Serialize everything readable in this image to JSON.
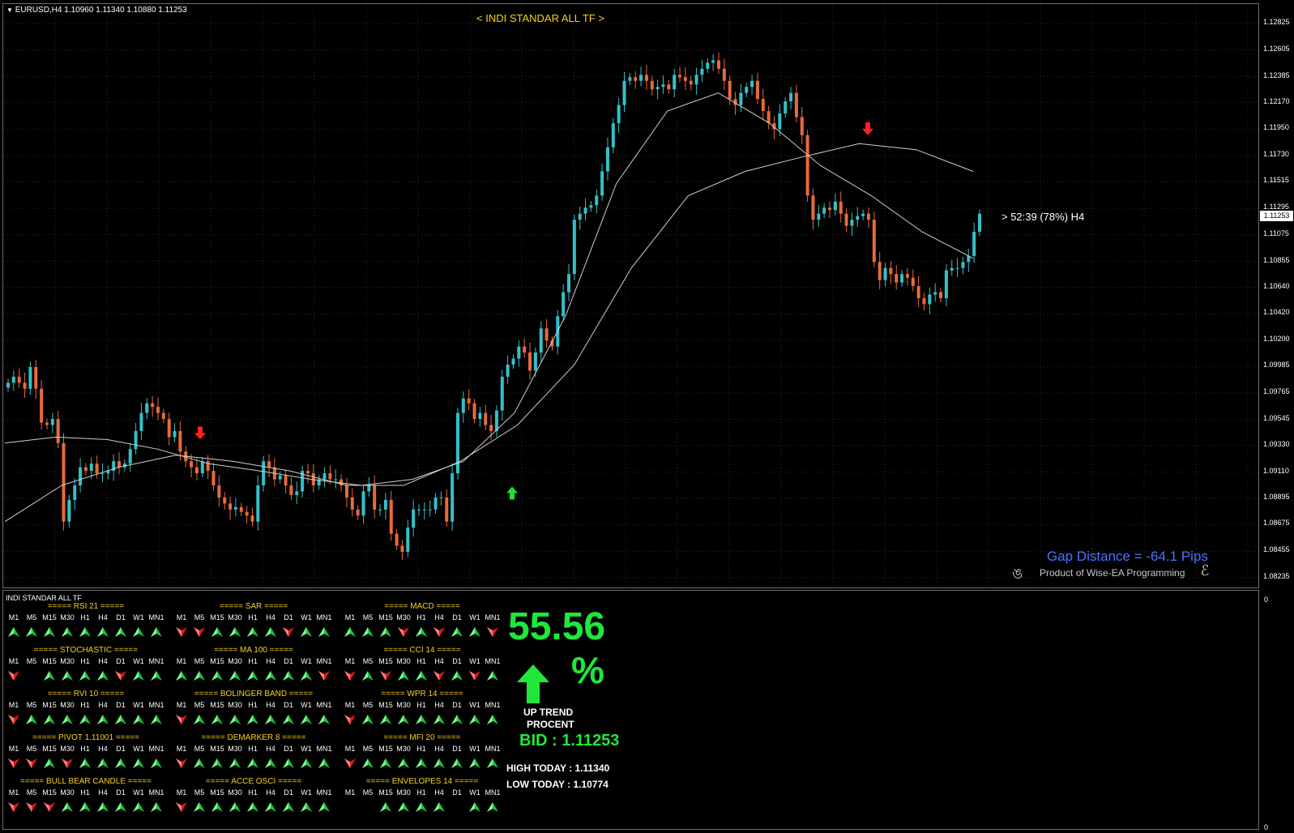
{
  "chart": {
    "symbol_header": "EURUSD,H4  1.10960 1.11340 1.10880 1.11253",
    "indicator_title": "< INDI STANDAR ALL TF >",
    "countdown": "> 52:39 (78%) H4",
    "gap_distance": "Gap Distance = -64.1 Pips",
    "product_credit": "Product of Wise-EA Programming",
    "current_price_tag": "1.11253",
    "price_ticks": [
      "1.12825",
      "1.12605",
      "1.12385",
      "1.12170",
      "1.11950",
      "1.11730",
      "1.11515",
      "1.11295",
      "1.11075",
      "1.10855",
      "1.10640",
      "1.10420",
      "1.10200",
      "1.09985",
      "1.09765",
      "1.09545",
      "1.09330",
      "1.09110",
      "1.08895",
      "1.08675",
      "1.08455",
      "1.08235"
    ],
    "colors": {
      "bull": "#35c0c8",
      "bear": "#e86a3a",
      "ma": "#cfcfcf",
      "signal_down": "#ff2020",
      "signal_up": "#20e030"
    }
  },
  "chart_data": {
    "type": "candlestick",
    "symbol": "EURUSD",
    "timeframe": "H4",
    "ylim": [
      1.08235,
      1.12825
    ],
    "close": [
      1.0985,
      1.099,
      1.0985,
      1.098,
      1.0998,
      1.098,
      1.0952,
      1.095,
      1.0955,
      1.0935,
      1.087,
      1.0888,
      1.09,
      1.0915,
      1.0912,
      1.0918,
      1.091,
      1.091,
      1.0912,
      1.092,
      1.0915,
      1.0918,
      1.093,
      1.0945,
      1.096,
      1.0968,
      1.0965,
      1.096,
      1.0955,
      1.094,
      1.0945,
      1.0928,
      1.092,
      1.0915,
      1.091,
      1.092,
      1.0912,
      1.09,
      1.089,
      1.0885,
      1.088,
      1.0882,
      1.0878,
      1.0875,
      1.087,
      1.09,
      1.092,
      1.0915,
      1.0905,
      1.0908,
      1.09,
      1.0892,
      1.0895,
      1.0912,
      1.091,
      1.09,
      1.0905,
      1.091,
      1.0905,
      1.0905,
      1.09,
      1.089,
      1.088,
      1.0875,
      1.0895,
      1.09,
      1.088,
      1.088,
      1.0888,
      1.086,
      1.085,
      1.0845,
      1.0865,
      1.088,
      1.088,
      1.088,
      1.088,
      1.089,
      1.089,
      1.087,
      1.091,
      1.096,
      1.0972,
      1.0968,
      1.0955,
      1.096,
      1.095,
      1.0945,
      1.0962,
      1.099,
      1.1,
      1.1005,
      1.1015,
      1.101,
      1.0995,
      1.101,
      1.103,
      1.102,
      1.1015,
      1.104,
      1.106,
      1.1075,
      1.112,
      1.1125,
      1.113,
      1.1132,
      1.114,
      1.116,
      1.118,
      1.12,
      1.1215,
      1.1235,
      1.1238,
      1.1235,
      1.124,
      1.1235,
      1.1228,
      1.123,
      1.1232,
      1.1228,
      1.124,
      1.1238,
      1.1235,
      1.1232,
      1.124,
      1.1245,
      1.125,
      1.1252,
      1.1245,
      1.1235,
      1.122,
      1.1215,
      1.1225,
      1.123,
      1.1235,
      1.122,
      1.121,
      1.12,
      1.1195,
      1.1208,
      1.1218,
      1.1225,
      1.1205,
      1.119,
      1.114,
      1.112,
      1.1125,
      1.113,
      1.1128,
      1.1135,
      1.1125,
      1.1115,
      1.112,
      1.1123,
      1.1125,
      1.112,
      1.1085,
      1.107,
      1.108,
      1.1075,
      1.1068,
      1.1075,
      1.1072,
      1.1065,
      1.1055,
      1.105,
      1.1058,
      1.106,
      1.1055,
      1.1078,
      1.108,
      1.108,
      1.1085,
      1.109,
      1.111,
      1.1125
    ],
    "moving_averages": [
      {
        "values": [
          1.0935,
          1.094,
          1.0938,
          1.093,
          1.0918,
          1.0912,
          1.0905,
          1.09,
          1.0905,
          1.092,
          1.096,
          1.104,
          1.115,
          1.121,
          1.1225,
          1.12,
          1.1165,
          1.114,
          1.111,
          1.1088
        ]
      },
      {
        "values": [
          1.087,
          1.09,
          1.0915,
          1.0925,
          1.092,
          1.0912,
          1.09,
          1.09,
          1.092,
          1.095,
          1.1,
          1.108,
          1.114,
          1.116,
          1.1172,
          1.1183,
          1.1178,
          1.116
        ]
      }
    ],
    "signals": [
      {
        "type": "sell",
        "price": 1.0938
      },
      {
        "type": "buy",
        "price": 1.0899
      },
      {
        "type": "sell",
        "price": 1.119
      }
    ],
    "subwindow_scale": [
      "0",
      "0"
    ]
  },
  "panel": {
    "title": "INDI STANDAR ALL TF",
    "timeframes": [
      "M1",
      "M5",
      "M15",
      "M30",
      "H1",
      "H4",
      "D1",
      "W1",
      "MN1"
    ],
    "blocks": [
      {
        "title": "===== RSI 21 =====",
        "signals": [
          "up",
          "up",
          "up",
          "up",
          "up",
          "up",
          "up",
          "up",
          "up"
        ]
      },
      {
        "title": "===== SAR =====",
        "signals": [
          "down",
          "down",
          "up",
          "up",
          "up",
          "up",
          "down",
          "up",
          "up"
        ]
      },
      {
        "title": "===== MACD =====",
        "signals": [
          "up",
          "up",
          "up",
          "down",
          "up",
          "down",
          "up",
          "up",
          "down"
        ]
      },
      {
        "title": "===== STOCHASTIC =====",
        "signals": [
          "down",
          "none",
          "up",
          "up",
          "up",
          "up",
          "down",
          "up",
          "up"
        ]
      },
      {
        "title": "===== MA 100 =====",
        "signals": [
          "up",
          "up",
          "up",
          "up",
          "up",
          "up",
          "up",
          "up",
          "down"
        ]
      },
      {
        "title": "===== CCI 14 =====",
        "signals": [
          "down",
          "up",
          "down",
          "up",
          "up",
          "down",
          "up",
          "down",
          "up"
        ]
      },
      {
        "title": "===== RVI 10 =====",
        "signals": [
          "down",
          "up",
          "up",
          "up",
          "up",
          "up",
          "up",
          "up",
          "up"
        ]
      },
      {
        "title": "===== BOLINGER BAND =====",
        "signals": [
          "down",
          "up",
          "up",
          "up",
          "up",
          "up",
          "up",
          "up",
          "up"
        ]
      },
      {
        "title": "===== WPR 14 =====",
        "signals": [
          "down",
          "up",
          "up",
          "up",
          "up",
          "up",
          "up",
          "up",
          "up"
        ]
      },
      {
        "title": "===== PIVOT 1.11001 =====",
        "signals": [
          "down",
          "down",
          "up",
          "down",
          "up",
          "up",
          "up",
          "up",
          "up"
        ]
      },
      {
        "title": "===== DEMARKER 8 =====",
        "signals": [
          "down",
          "up",
          "up",
          "up",
          "up",
          "up",
          "up",
          "up",
          "up"
        ]
      },
      {
        "title": "===== MFI 20 =====",
        "signals": [
          "down",
          "up",
          "up",
          "up",
          "up",
          "up",
          "up",
          "up",
          "up"
        ]
      },
      {
        "title": "===== BULL BEAR CANDLE =====",
        "signals": [
          "down",
          "down",
          "down",
          "up",
          "up",
          "up",
          "up",
          "up",
          "up"
        ]
      },
      {
        "title": "===== ACCE OSCI =====",
        "signals": [
          "down",
          "up",
          "up",
          "up",
          "up",
          "up",
          "up",
          "up",
          "up"
        ]
      },
      {
        "title": "===== ENVELOPES 14 =====",
        "signals": [
          "none",
          "none",
          "up",
          "up",
          "up",
          "up",
          "none",
          "up",
          "up"
        ]
      }
    ],
    "trend_percent": "55.56",
    "percent_sign": "%",
    "trend_label_line1": "UP TREND",
    "trend_label_line2": "PROCENT",
    "bid_text": "BID : 1.11253",
    "high_today": "HIGH TODAY  : 1.11340",
    "low_today": "LOW TODAY   : 1.10774"
  }
}
